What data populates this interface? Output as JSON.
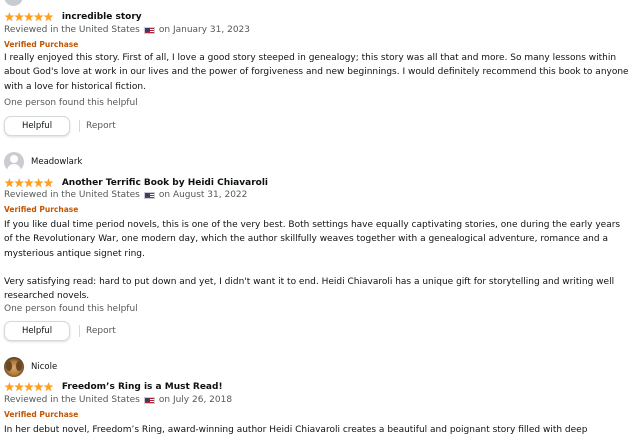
{
  "reviews": [
    {
      "reviewer": "",
      "avatar": "default-avatar",
      "rating": 5,
      "title": "incredible story",
      "reviewed_prefix": "Reviewed in the United States",
      "reviewed_date": "on January 31, 2023",
      "verified": "Verified Purchase",
      "body": [
        "I really enjoyed this story. First of all, I love a good story steeped in genealogy; this story was all that and more. So many lessons within about God's love at work in our lives and the power of forgiveness and new beginnings. I would definitely recommend this book to anyone with a love for historical fiction."
      ],
      "helpful_count": "One person found this helpful",
      "helpful_label": "Helpful",
      "report_label": "Report"
    },
    {
      "reviewer": "Meadowlark",
      "avatar": "default-avatar",
      "rating": 5,
      "title": "Another Terrific Book by Heidi Chiavaroli",
      "reviewed_prefix": "Reviewed in the United States",
      "reviewed_date": "on August 31, 2022",
      "verified": "Verified Purchase",
      "body": [
        "If you like dual time period novels, this is one of the very best. Both settings have equally captivating stories, one during the early years of the Revolutionary War, one modern day, which the author skillfully weaves together with a genealogical adventure, romance and a mysterious antique signet ring.",
        "Very satisfying read: hard to put down and yet, I didn't want it to end. Heidi Chiavaroli has a unique gift for storytelling and writing well researched novels."
      ],
      "helpful_count": "One person found this helpful",
      "helpful_label": "Helpful",
      "report_label": "Report"
    },
    {
      "reviewer": "Nicole",
      "avatar": "dog-photo-avatar",
      "rating": 5,
      "title": "Freedom’s Ring is a Must Read!",
      "reviewed_prefix": "Reviewed in the United States",
      "reviewed_date": "on July 26, 2018",
      "verified": "Verified Purchase",
      "body": [
        "In her debut novel, Freedom’s Ring, award-winning author Heidi Chiavaroli creates a beautiful and poignant story filled with deep emotion,"
      ]
    }
  ],
  "icons": {
    "star": "star-icon",
    "flag": "us-flag-icon"
  },
  "colors": {
    "star": "#ff9f1a",
    "verified": "#c45500",
    "muted_text": "#565959"
  }
}
